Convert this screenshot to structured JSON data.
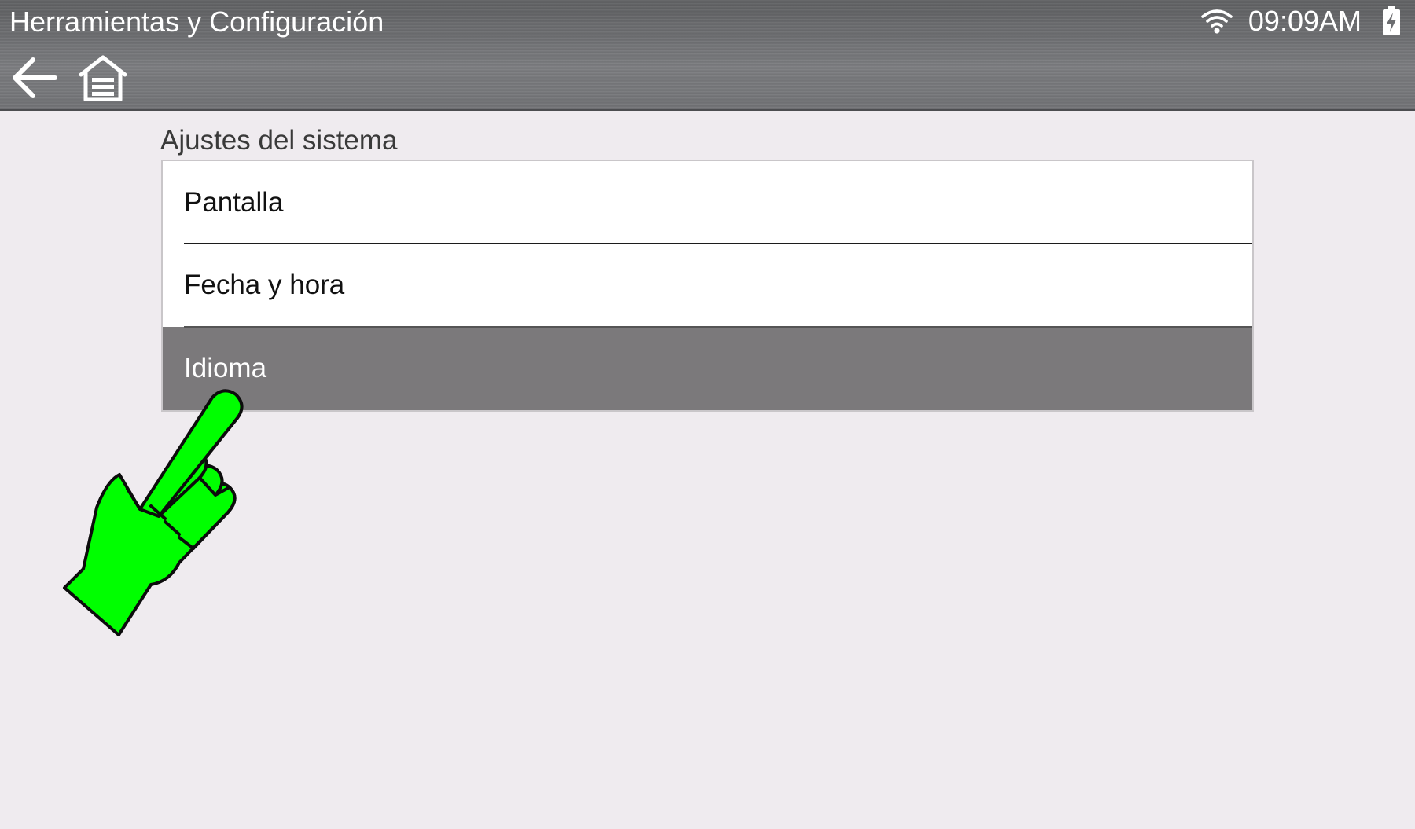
{
  "header": {
    "title": "Herramientas y Configuración",
    "time": "09:09AM",
    "icons": {
      "wifi": "wifi-icon",
      "battery": "battery-charging-icon",
      "back": "back-arrow-icon",
      "home": "home-icon"
    }
  },
  "main": {
    "section_title": "Ajustes del sistema",
    "items": [
      {
        "label": "Pantalla",
        "selected": false
      },
      {
        "label": "Fecha y hora",
        "selected": false
      },
      {
        "label": "Idioma",
        "selected": true
      }
    ]
  },
  "overlay": {
    "icon": "pointing-hand-icon",
    "color": "#00ff00"
  },
  "colors": {
    "selected_row": "#7b797b",
    "background": "#efebef"
  }
}
